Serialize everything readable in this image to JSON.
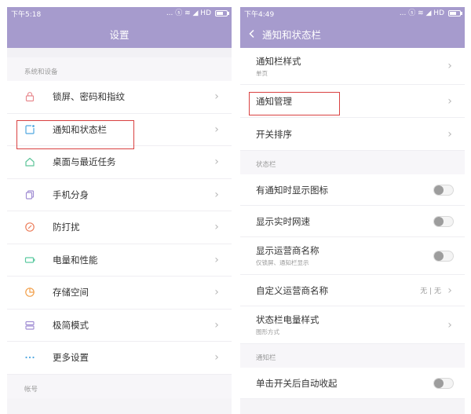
{
  "left": {
    "status_time": "下午5:18",
    "status_right": "... ⓢ ≋ ◢ HD",
    "title": "设置",
    "section1": "系统和设备",
    "items": [
      {
        "label": "锁屏、密码和指纹",
        "icon": "lock-icon",
        "color": "#e88a8f"
      },
      {
        "label": "通知和状态栏",
        "icon": "notification-icon",
        "color": "#4fa7e0"
      },
      {
        "label": "桌面与最近任务",
        "icon": "home-icon",
        "color": "#5fc59a"
      },
      {
        "label": "手机分身",
        "icon": "clone-icon",
        "color": "#a28fd4"
      },
      {
        "label": "防打扰",
        "icon": "compass-icon",
        "color": "#ec7f5d"
      },
      {
        "label": "电量和性能",
        "icon": "battery-icon",
        "color": "#5cc9a0"
      },
      {
        "label": "存储空间",
        "icon": "pie-icon",
        "color": "#f2a04b"
      },
      {
        "label": "极简模式",
        "icon": "layers-icon",
        "color": "#a28fd4"
      },
      {
        "label": "更多设置",
        "icon": "more-icon",
        "color": "#4fa7e0"
      }
    ],
    "section2": "帐号"
  },
  "right": {
    "status_time": "下午4:49",
    "status_right": "... ⓢ ≋ ◢ HD",
    "title": "通知和状态栏",
    "group1": [
      {
        "label": "通知栏样式",
        "sub": "单页"
      },
      {
        "label": "通知管理"
      },
      {
        "label": "开关排序"
      }
    ],
    "section_status": "状态栏",
    "group2": [
      {
        "label": "有通知时显示图标",
        "control": "toggle"
      },
      {
        "label": "显示实时网速",
        "control": "toggle"
      },
      {
        "label": "显示运营商名称",
        "sub": "仅锁屏、通知栏显示",
        "control": "toggle"
      },
      {
        "label": "自定义运营商名称",
        "value": "无 | 无",
        "control": "chevron"
      },
      {
        "label": "状态栏电量样式",
        "sub": "图形方式",
        "control": "chevron"
      }
    ],
    "section_notify": "通知栏",
    "group3": [
      {
        "label": "单击开关后自动收起",
        "control": "toggle"
      }
    ]
  },
  "colors": {
    "header": "#a69bcd",
    "highlight": "#d94141"
  }
}
